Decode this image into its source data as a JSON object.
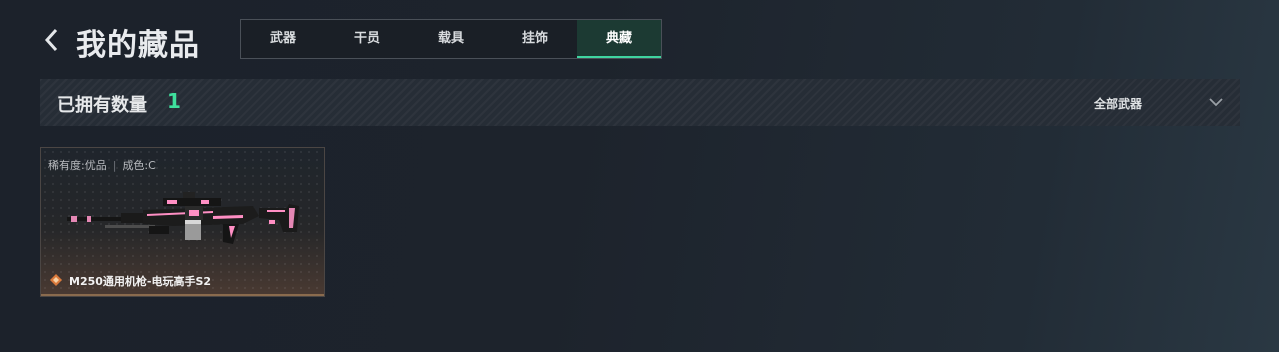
{
  "header": {
    "title": "我的藏品"
  },
  "tabs": [
    {
      "label": "武器"
    },
    {
      "label": "干员"
    },
    {
      "label": "载具"
    },
    {
      "label": "挂饰"
    },
    {
      "label": "典藏",
      "active": true
    }
  ],
  "summary": {
    "owned_label": "已拥有数量",
    "owned_count": "1",
    "accent_color": "#3fe09d"
  },
  "filter": {
    "selected": "全部武器"
  },
  "items": [
    {
      "rarity": "稀有度:优品",
      "condition": "成色:C",
      "name": "M250通用机枪-电玩高手S2",
      "icon": "rarity-diamond-icon"
    }
  ]
}
